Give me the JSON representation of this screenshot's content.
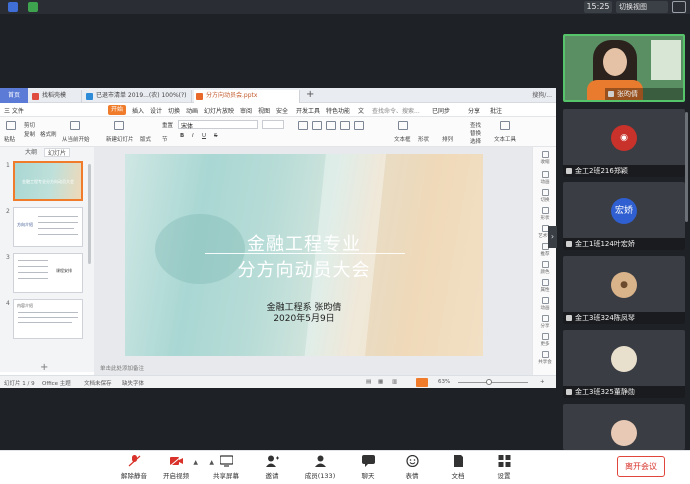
{
  "topbar": {
    "time": "15:25",
    "switch_view": "切换视图",
    "icons": [
      "shield-icon",
      "signal-icon",
      "fullscreen-icon"
    ]
  },
  "wps": {
    "tabs": [
      {
        "label": "首页"
      },
      {
        "label": "找稻壳模"
      },
      {
        "label": "已退市清单 2019...(农)  100%(?)"
      },
      {
        "label": "分方向动员会.pptx"
      }
    ],
    "tabs_right": "搜狗/...",
    "menu": [
      "三 文件",
      "开始",
      "插入",
      "设计",
      "切换",
      "动画",
      "幻灯片放映",
      "审阅",
      "视图",
      "安全",
      "开发工具",
      "特色功能",
      "文",
      "查找命令、搜索..."
    ],
    "menu_right": [
      "已同步",
      "分享",
      "批注"
    ],
    "ribbon": {
      "paste": "粘贴",
      "cut": "剪切",
      "copy": "复制",
      "format_painter": "格式刷",
      "from_current": "从当前开始",
      "new_slide": "新建幻灯片",
      "layout": "版式",
      "section": "节",
      "reset": "重置",
      "font_name": "宋体",
      "textbox": "文本框",
      "shape": "形状",
      "arrange": "排列",
      "text_tools": "文本工具",
      "find": "查找",
      "replace": "替换",
      "select": "选择"
    },
    "view_toggle": [
      "大纲",
      "幻灯片"
    ],
    "thumbnails": [
      {
        "num": "1",
        "title": "金融工程专业分方向动员大会"
      },
      {
        "num": "2",
        "title": "方向介绍"
      },
      {
        "num": "3",
        "title": "课程安排"
      },
      {
        "num": "4",
        "title": "内容介绍"
      }
    ],
    "slide": {
      "title_line1": "金融工程专业",
      "title_line2": "分方向动员大会",
      "subtitle_line1": "金融工程系    张昀倩",
      "subtitle_line2": "2020年5月9日"
    },
    "notes_placeholder": "单击此处添加备注",
    "rail": [
      "收缩",
      "动画",
      "切换",
      "形状",
      "艺术字",
      "推荐",
      "颜色",
      "属性",
      "动画",
      "分享",
      "更多",
      "共享会"
    ],
    "status": {
      "slide_counter": "幻灯片 1 / 9",
      "theme": "Office 主题",
      "backup": "文档未保存",
      "font_missing": "缺失字体",
      "zoom": "63%"
    }
  },
  "participants": [
    {
      "name": "张昀倩",
      "type": "video"
    },
    {
      "name": "金工2班216郑颖",
      "type": "avatar",
      "avatar_color": "#c8322b"
    },
    {
      "name": "金工1班124叶宏娇",
      "type": "avatar",
      "avatar_color": "#2f5fd0",
      "avatar_text": "宏娇"
    },
    {
      "name": "金工3班324陈凤琴",
      "type": "avatar",
      "avatar_color": "#d9b48a"
    },
    {
      "name": "金工3班325董静勋",
      "type": "avatar",
      "avatar_color": "#e8e0cc"
    },
    {
      "name": "",
      "type": "avatar",
      "avatar_color": "#e7c9b5"
    }
  ],
  "bottombar": {
    "buttons": [
      {
        "label": "解除静音",
        "icon": "mic-muted-icon",
        "color": "#d8322a"
      },
      {
        "label": "开启视频",
        "icon": "camera-off-icon",
        "color": "#d8322a"
      },
      {
        "label": "共享屏幕",
        "icon": "screen-share-icon",
        "color": "#333333"
      },
      {
        "label": "邀请",
        "icon": "invite-icon",
        "color": "#333333"
      },
      {
        "label": "成员(133)",
        "icon": "members-icon",
        "color": "#333333"
      },
      {
        "label": "聊天",
        "icon": "chat-icon",
        "color": "#333333"
      },
      {
        "label": "表情",
        "icon": "emoji-icon",
        "color": "#333333"
      },
      {
        "label": "文档",
        "icon": "document-icon",
        "color": "#333333"
      },
      {
        "label": "设置",
        "icon": "settings-icon",
        "color": "#333333"
      }
    ],
    "leave_label": "离开会议"
  },
  "colors": {
    "accent": "#f07c2b",
    "leave": "#d8322a",
    "speaker_border": "#55c46a"
  }
}
